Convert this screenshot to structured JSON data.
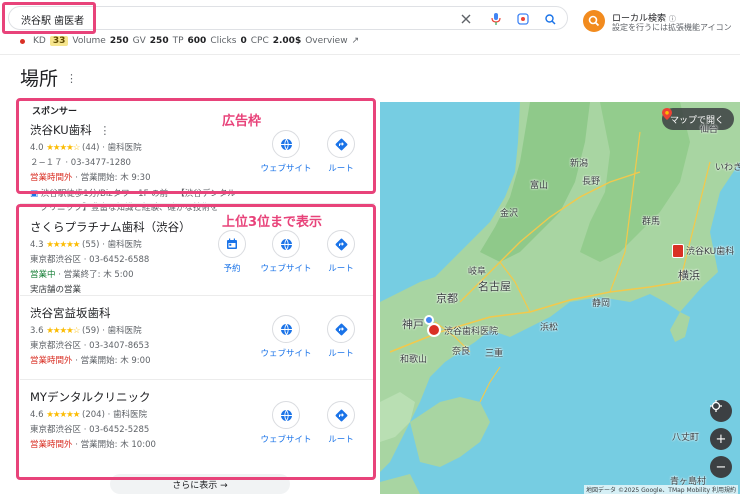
{
  "search": {
    "query": "渋谷駅 歯医者"
  },
  "seo": {
    "kd_label": "KD",
    "kd_value": "33",
    "volume_label": "Volume",
    "volume_value": "250",
    "gv_label": "GV",
    "gv_value": "250",
    "tp_label": "TP",
    "tp_value": "600",
    "clicks_label": "Clicks",
    "clicks_value": "0",
    "cpc_label": "CPC",
    "cpc_value": "2.00$",
    "overview_label": "Overview"
  },
  "local": {
    "title": "ローカル検索",
    "subtitle": "設定を行うには拡張機能アイコン"
  },
  "section": {
    "title": "場所",
    "sponsor_label": "スポンサー"
  },
  "annotations": {
    "ad_label": "広告枠",
    "top3_label": "上位3位まで表示"
  },
  "ad_listing": {
    "name": "渋谷KU歯科",
    "rating": "4.0",
    "stars": "★★★★☆",
    "reviews": "(44)",
    "category": "歯科医院",
    "address": "２−１７",
    "phone": "03-3477-1280",
    "status": "営業時間外",
    "hours": "営業開始: 木 9:30",
    "desc1": "渋谷駅徒歩1分/Bizタワー1F の前 · 【渋谷デンタル",
    "desc2": "クリニック】豊富な知識と経験、確かな技術を"
  },
  "listings": [
    {
      "name": "さくらプラチナム歯科（渋谷）",
      "rating": "4.3",
      "stars": "★★★★★",
      "reviews": "(55)",
      "category": "歯科医院",
      "address": "東京都渋谷区",
      "phone": "03-6452-6588",
      "status": "営業中",
      "hours": "営業終了: 木 5:00",
      "extra": "実店舗の営業"
    },
    {
      "name": "渋谷宮益坂歯科",
      "rating": "3.6",
      "stars": "★★★★☆",
      "reviews": "(59)",
      "category": "歯科医院",
      "address": "東京都渋谷区",
      "phone": "03-3407-8653",
      "status": "営業時間外",
      "hours": "営業開始: 木 9:00"
    },
    {
      "name": "MYデンタルクリニック",
      "rating": "4.6",
      "stars": "★★★★★",
      "reviews": "(204)",
      "category": "歯科医院",
      "address": "東京都渋谷区",
      "phone": "03-6452-5285",
      "status": "営業時間外",
      "hours": "営業開始: 木 10:00"
    }
  ],
  "actions": {
    "reserve": "予約",
    "website": "ウェブサイト",
    "route": "ルート"
  },
  "more": {
    "label": "さらに表示 →"
  },
  "map": {
    "open_label": "マップで開く",
    "attribution": "地図データ ©2025 Google、TMap Mobility  利用規約",
    "labels": {
      "iwaki": "いわき",
      "sendai": "仙台",
      "niigata": "新潟",
      "toyama": "富山",
      "nagano": "長野",
      "kanazawa": "金沢",
      "gunma": "群馬",
      "gifu": "岐阜",
      "nagoya": "名古屋",
      "kyoto": "京都",
      "kobe": "神戸",
      "shizuoka": "静岡",
      "hamamatsu": "浜松",
      "yokohama": "横浜",
      "wakayama": "和歌山",
      "mie": "三重",
      "nara": "奈良",
      "hachijo": "八丈町",
      "aogashima": "青ヶ島村",
      "tokyo_pin": "渋谷KU歯科",
      "osaka_pin": "渋谷歯科医院"
    }
  },
  "colors": {
    "accent": "#e8437a",
    "link": "#1a73e8",
    "closed": "#d93025",
    "open": "#188038",
    "star": "#fbbc04",
    "local_btn": "#f28b1e"
  }
}
